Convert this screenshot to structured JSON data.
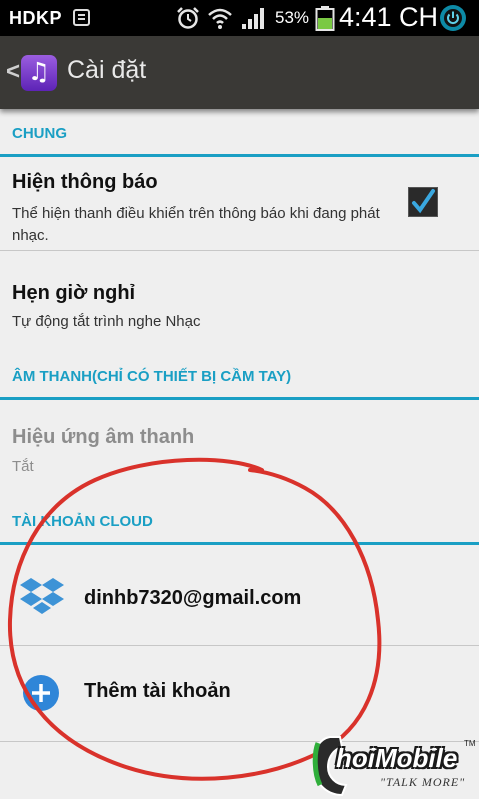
{
  "status_bar": {
    "carrier": "HDKP",
    "battery_percent": "53%",
    "time": "4:41 CH",
    "icons": [
      "message-icon",
      "alarm-icon",
      "wifi-icon",
      "signal-icon",
      "battery-icon",
      "power-icon"
    ]
  },
  "action_bar": {
    "back_glyph": "<",
    "app_icon": "music-note-icon",
    "title": "Cài đặt"
  },
  "sections": {
    "general": {
      "header": "CHUNG",
      "items": [
        {
          "title": "Hiện thông báo",
          "subtitle": "Thể hiện thanh điều khiển trên thông báo khi đang phát nhạc.",
          "checked": true
        },
        {
          "title": "Hẹn giờ nghỉ",
          "subtitle": "Tự động tắt trình nghe Nhạc"
        }
      ]
    },
    "sound": {
      "header": "ÂM THANH(CHỈ CÓ THIẾT BỊ CẦM TAY)",
      "items": [
        {
          "title": "Hiệu ứng âm thanh",
          "subtitle": "Tắt",
          "enabled": false
        }
      ]
    },
    "cloud": {
      "header": "TÀI KHOẢN CLOUD",
      "accounts": [
        {
          "label": "dinhb7320@gmail.com",
          "icon": "dropbox-icon"
        },
        {
          "label": "Thêm tài khoản",
          "icon": "add-circle-icon"
        }
      ]
    }
  },
  "watermark": {
    "brand": "hoiMobile",
    "tagline": "\"TALK MORE\"",
    "tm": "TM"
  },
  "colors": {
    "accent": "#1a9fc4",
    "annotation": "#d9322b",
    "action_bar": "#3a3936",
    "background": "#efefef"
  }
}
